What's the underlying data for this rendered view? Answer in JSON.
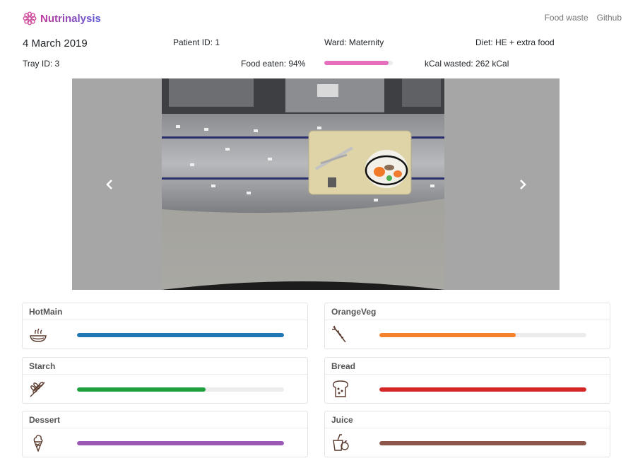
{
  "app": {
    "brand": "Nutrinalysis",
    "nav": [
      "Food waste",
      "Github"
    ]
  },
  "tray": {
    "date": "4 March 2019",
    "patient": "Patient ID: 1",
    "ward": "Ward: Maternity",
    "diet": "Diet: HE + extra food",
    "tray_id": "Tray ID: 3",
    "food_eaten": "Food eaten: 94%",
    "food_eaten_fraction": 0.94,
    "kcal_wasted": "kCal wasted: 262 kCal"
  },
  "colors": {
    "eaten": "#e76ebd",
    "hotmain": "#1f77b4",
    "orangeveg": "#f5822a",
    "starch": "#1ea03c",
    "bread": "#d62728",
    "dessert": "#9b59b6",
    "juice": "#8c564b"
  },
  "categories": [
    {
      "name": "HotMain",
      "icon": "hot-meal-icon",
      "fraction": 1.0,
      "color": "#1f77b4"
    },
    {
      "name": "OrangeVeg",
      "icon": "carrot-icon",
      "fraction": 0.66,
      "color": "#f5822a"
    },
    {
      "name": "Starch",
      "icon": "wheat-icon",
      "fraction": 0.62,
      "color": "#1ea03c"
    },
    {
      "name": "Bread",
      "icon": "bread-icon",
      "fraction": 1.0,
      "color": "#d62728"
    },
    {
      "name": "Dessert",
      "icon": "ice-cream-icon",
      "fraction": 1.0,
      "color": "#9b59b6"
    },
    {
      "name": "Juice",
      "icon": "juice-icon",
      "fraction": 1.0,
      "color": "#8c564b"
    }
  ]
}
